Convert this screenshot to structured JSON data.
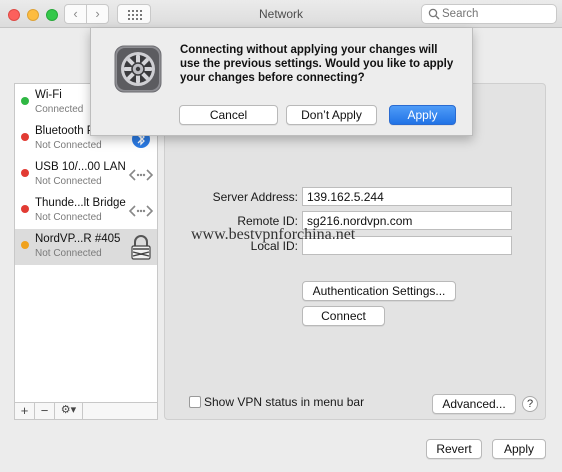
{
  "window": {
    "title": "Network"
  },
  "search": {
    "placeholder": "Search"
  },
  "services": [
    {
      "name": "Wi-Fi",
      "status": "Connected",
      "color": "#2fb743"
    },
    {
      "name": "Bluetooth P",
      "status": "Not Connected",
      "color": "#e23b33"
    },
    {
      "name": "USB 10/...00 LAN",
      "status": "Not Connected",
      "color": "#e23b33"
    },
    {
      "name": "Thunde...lt Bridge",
      "status": "Not Connected",
      "color": "#e23b33"
    },
    {
      "name": "NordVP...R #405",
      "status": "Not Connected",
      "color": "#f0a21e"
    }
  ],
  "sidebar_tools": {
    "add": "+",
    "remove": "−",
    "action": "⚙▾"
  },
  "form": {
    "server_address_label": "Server Address:",
    "server_address_value": "139.162.5.244",
    "remote_id_label": "Remote ID:",
    "remote_id_value": "sg216.nordvpn.com",
    "local_id_label": "Local ID:",
    "local_id_value": "",
    "auth_button": "Authentication Settings...",
    "connect_button": "Connect",
    "show_status_label": "Show VPN status in menu bar",
    "advanced_button": "Advanced...",
    "help": "?"
  },
  "footer": {
    "revert": "Revert",
    "apply": "Apply"
  },
  "dialog": {
    "message": "Connecting without applying your changes will use the previous settings. Would you like to apply your changes before connecting?",
    "cancel": "Cancel",
    "dont_apply": "Don’t Apply",
    "apply": "Apply"
  },
  "watermark": "www.bestvpnforchina.net",
  "accent_color": "#2173e6"
}
